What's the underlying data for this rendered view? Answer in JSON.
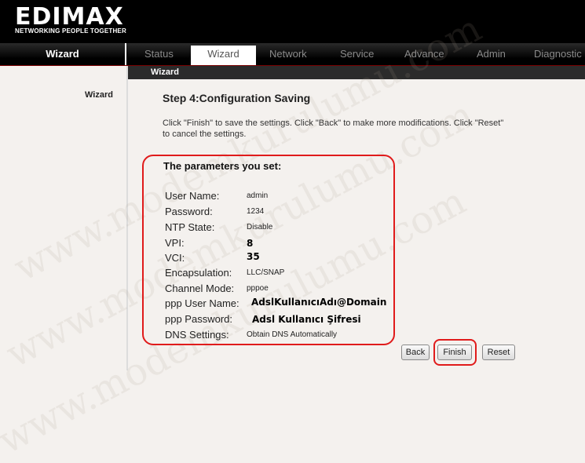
{
  "brand": {
    "logo_text": "EDIMAX",
    "tagline": "NETWORKING PEOPLE TOGETHER"
  },
  "nav": {
    "section_label": "Wizard",
    "tabs": [
      {
        "label": "Status"
      },
      {
        "label": "Wizard",
        "active": true
      },
      {
        "label": "Network"
      },
      {
        "label": "Service"
      },
      {
        "label": "Advance"
      },
      {
        "label": "Admin"
      },
      {
        "label": "Diagnostic"
      }
    ]
  },
  "subbar": {
    "title": "Wizard"
  },
  "sidebar": {
    "label": "Wizard"
  },
  "main": {
    "step_title": "Step 4:Configuration Saving",
    "description": "Click \"Finish\" to save the settings. Click \"Back\" to make more modifications. Click \"Reset\" to cancel the settings.",
    "params_title": "The parameters you set:",
    "params": [
      {
        "label": "User Name:",
        "value": "admin"
      },
      {
        "label": "Password:",
        "value": "1234"
      },
      {
        "label": "NTP State:",
        "value": "Disable"
      },
      {
        "label": "VPI:",
        "value": "8"
      },
      {
        "label": "VCI:",
        "value": "35"
      },
      {
        "label": "Encapsulation:",
        "value": "LLC/SNAP"
      },
      {
        "label": "Channel Mode:",
        "value": "pppoe"
      },
      {
        "label": "ppp User Name:",
        "value": "AdslKullanıcıAdı@Domain"
      },
      {
        "label": "ppp Password:",
        "value": "Adsl Kullanıcı Şifresi"
      },
      {
        "label": "DNS Settings:",
        "value": "Obtain DNS Automatically"
      }
    ]
  },
  "buttons": {
    "back": "Back",
    "finish": "Finish",
    "reset": "Reset"
  },
  "watermark_text": "www.modemkurulumu.com",
  "colors": {
    "highlight": "#e01b1b",
    "header_bg": "#000000",
    "page_bg": "#f4f1ee"
  }
}
